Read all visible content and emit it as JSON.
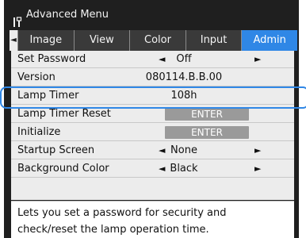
{
  "window": {
    "title": "Advanced Menu"
  },
  "tabs": [
    {
      "label": "Image",
      "active": false
    },
    {
      "label": "View",
      "active": false
    },
    {
      "label": "Color",
      "active": false
    },
    {
      "label": "Input",
      "active": false
    },
    {
      "label": "Admin",
      "active": true
    }
  ],
  "rows": [
    {
      "label": "Set Password",
      "value": "Off",
      "arrows": true,
      "button": false
    },
    {
      "label": "Version",
      "value": "080114.B.B.00",
      "arrows": false,
      "button": false
    },
    {
      "label": "Lamp Timer",
      "value": "108h",
      "arrows": false,
      "button": false,
      "selected": true
    },
    {
      "label": "Lamp Timer Reset",
      "value": "ENTER",
      "arrows": false,
      "button": true
    },
    {
      "label": "Initialize",
      "value": "ENTER",
      "arrows": false,
      "button": true
    },
    {
      "label": "Startup Screen",
      "value": "None",
      "arrows": true,
      "button": false
    },
    {
      "label": "Background Color",
      "value": "Black",
      "arrows": true,
      "button": false
    }
  ],
  "arrow_left": "◄",
  "arrow_right": "►",
  "info": {
    "line1": "Lets you set a password for security and",
    "line2": "check/reset the lamp operation time."
  },
  "colors": {
    "accent": "#2f87e6",
    "frame": "#1f1f1f",
    "menu_bg": "#ececec",
    "button": "#9a9a9a"
  },
  "icons": {
    "title_icon": "tools-icon"
  }
}
